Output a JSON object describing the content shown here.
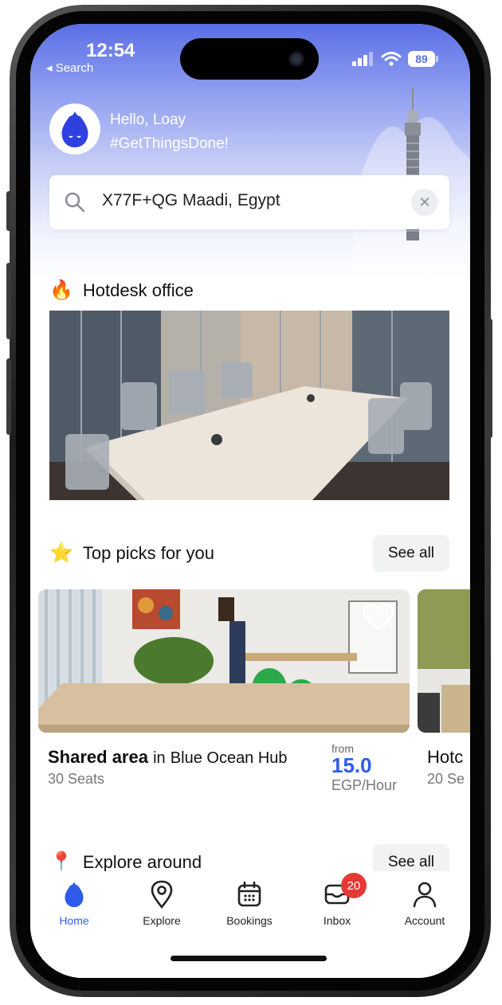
{
  "status_bar": {
    "time": "12:54",
    "back_label": "◂ Search",
    "battery": "89"
  },
  "header": {
    "greeting": "Hello, Loay",
    "tagline": "#GetThingsDone!"
  },
  "search": {
    "location": "X77F+QG Maadi, Egypt"
  },
  "sections": {
    "hotdesk_title": "Hotdesk office",
    "top_picks_title": "Top picks for you",
    "top_picks_see_all": "See all",
    "explore_title": "Explore around",
    "explore_see_all": "See all"
  },
  "cards": [
    {
      "name": "Shared area",
      "connector": "in",
      "venue": "Blue Ocean Hub",
      "seats": "30 Seats",
      "price_from": "from",
      "price": "15.0",
      "price_unit": "EGP/Hour"
    },
    {
      "name": "Hotc",
      "seats": "20 Se"
    }
  ],
  "tabbar": {
    "items": [
      {
        "label": "Home",
        "icon": "home-flame-icon",
        "active": true
      },
      {
        "label": "Explore",
        "icon": "map-pin-icon"
      },
      {
        "label": "Bookings",
        "icon": "calendar-icon"
      },
      {
        "label": "Inbox",
        "icon": "inbox-icon",
        "badge": "20"
      },
      {
        "label": "Account",
        "icon": "user-icon"
      }
    ]
  },
  "colors": {
    "accent": "#2f5bea",
    "badge": "#e53935",
    "hero_top": "#5b6fe6"
  }
}
